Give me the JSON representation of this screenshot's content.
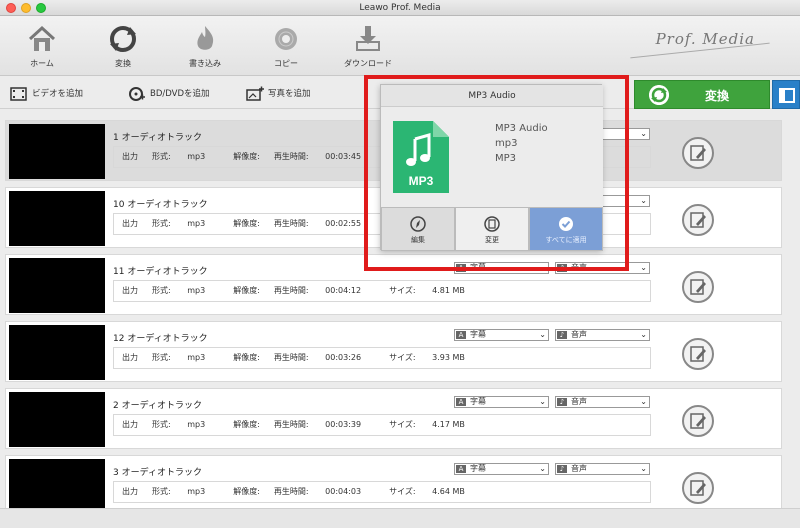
{
  "window": {
    "title": "Leawo Prof. Media"
  },
  "toolbar": {
    "home_label": "ホーム",
    "convert_label": "変換",
    "burn_label": "書き込み",
    "copy_label": "コピー",
    "download_label": "ダウンロード",
    "brand": "Prof. Media"
  },
  "subbar": {
    "add_video": "ビデオを追加",
    "add_bd_dvd": "BD/DVDを追加",
    "add_photo": "写真を追加",
    "convert_button": "変換"
  },
  "popup": {
    "title": "MP3 Audio",
    "format_name": "MP3 Audio",
    "extension": "mp3",
    "codec": "MP3",
    "icon_text": "MP3",
    "edit_label": "編集",
    "change_label": "変更",
    "apply_all_label": "すべてに適用"
  },
  "labels": {
    "output": "出力",
    "format": "形式:",
    "resolution": "解像度:",
    "duration": "再生時間:",
    "size": "サイズ:"
  },
  "rows": [
    {
      "title": "1 オーディオトラック",
      "format": "mp3",
      "duration": "00:03:45",
      "size": "",
      "subtitle": "",
      "audio": ""
    },
    {
      "title": "10 オーディオトラック",
      "format": "mp3",
      "duration": "00:02:55",
      "size": "",
      "subtitle": "",
      "audio": ""
    },
    {
      "title": "11 オーディオトラック",
      "format": "mp3",
      "duration": "00:04:12",
      "size": "4.81 MB",
      "subtitle": "字幕",
      "audio": "音声"
    },
    {
      "title": "12 オーディオトラック",
      "format": "mp3",
      "duration": "00:03:26",
      "size": "3.93 MB",
      "subtitle": "字幕",
      "audio": "音声"
    },
    {
      "title": "2 オーディオトラック",
      "format": "mp3",
      "duration": "00:03:39",
      "size": "4.17 MB",
      "subtitle": "字幕",
      "audio": "音声"
    },
    {
      "title": "3 オーディオトラック",
      "format": "mp3",
      "duration": "00:04:03",
      "size": "4.64 MB",
      "subtitle": "字幕",
      "audio": "音声"
    }
  ],
  "colors": {
    "convert_green": "#3fa33d",
    "highlight_red": "#e01b1b",
    "mp3_green": "#2bb673",
    "apply_blue": "#7c9fd6"
  }
}
